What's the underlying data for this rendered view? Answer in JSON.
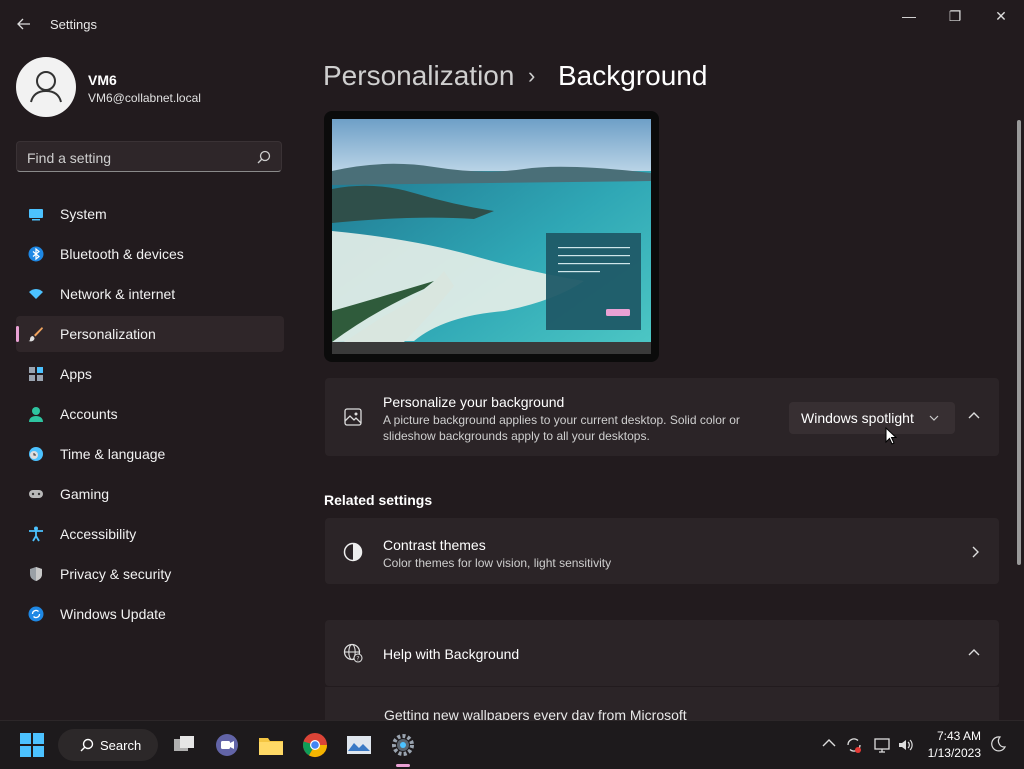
{
  "window": {
    "title": "Settings",
    "back_icon": "back-arrow-icon",
    "minimize": "—",
    "maximize": "❐",
    "close": "✕"
  },
  "user": {
    "name": "VM6",
    "email": "VM6@collabnet.local"
  },
  "search": {
    "placeholder": "Find a setting"
  },
  "sidebar": {
    "items": [
      {
        "label": "System",
        "icon": "system-icon"
      },
      {
        "label": "Bluetooth & devices",
        "icon": "bluetooth-icon"
      },
      {
        "label": "Network & internet",
        "icon": "wifi-icon"
      },
      {
        "label": "Personalization",
        "icon": "brush-icon",
        "active": true
      },
      {
        "label": "Apps",
        "icon": "apps-icon"
      },
      {
        "label": "Accounts",
        "icon": "accounts-icon"
      },
      {
        "label": "Time & language",
        "icon": "globe-clock-icon"
      },
      {
        "label": "Gaming",
        "icon": "gamepad-icon"
      },
      {
        "label": "Accessibility",
        "icon": "accessibility-icon"
      },
      {
        "label": "Privacy & security",
        "icon": "shield-icon"
      },
      {
        "label": "Windows Update",
        "icon": "update-icon"
      }
    ]
  },
  "breadcrumb": {
    "parent": "Personalization",
    "separator": "›",
    "current": "Background"
  },
  "background_card": {
    "title": "Personalize your background",
    "desc_line1": "A picture background applies to your current desktop. Solid color or",
    "desc_line2": "slideshow backgrounds apply to all your desktops.",
    "selected": "Windows spotlight"
  },
  "related": {
    "heading": "Related settings",
    "contrast": {
      "title": "Contrast themes",
      "desc": "Color themes for low vision, light sensitivity"
    }
  },
  "help": {
    "title": "Help with Background",
    "item": "Getting new wallpapers every day from Microsoft"
  },
  "taskbar": {
    "search_label": "Search",
    "time": "7:43 AM",
    "date": "1/13/2023"
  },
  "colors": {
    "accent": "#e9a1d4",
    "window_bg": "#221b1e",
    "card_bg": "#2b2427"
  }
}
